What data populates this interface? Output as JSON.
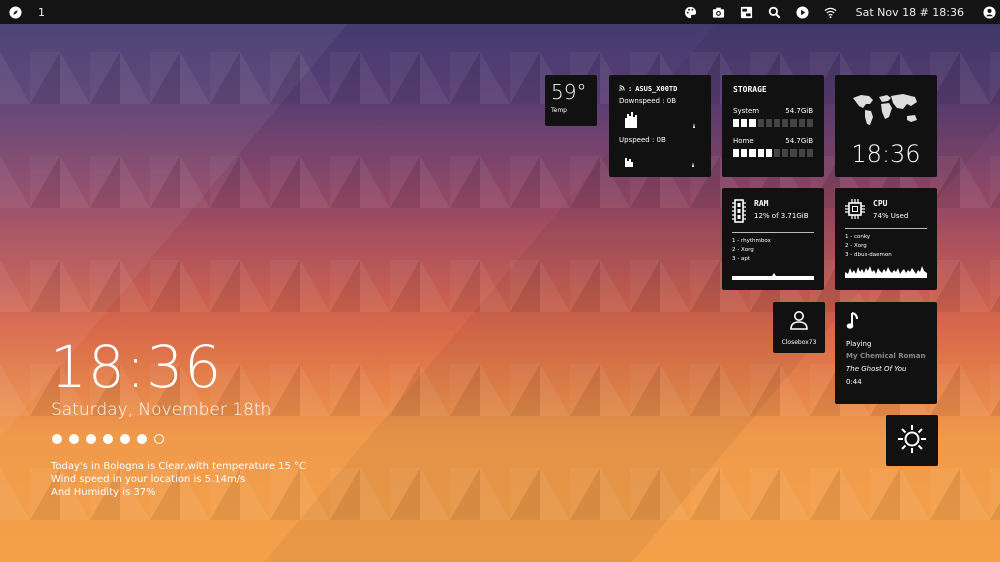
{
  "topbar": {
    "workspace": "1",
    "datetime": "Sat Nov 18 # 18:36",
    "icons": [
      "compass-icon",
      "palette-icon",
      "camera-icon",
      "toggle-icon",
      "search-icon",
      "play-icon",
      "wifi-icon",
      "user-icon"
    ]
  },
  "temp": {
    "value": "59°",
    "label": "Temp"
  },
  "network": {
    "ssid": "ASUS_X00TD",
    "down_label": "Downspeed : 0B",
    "up_label": "Upspeed : 0B"
  },
  "storage": {
    "title": "STORAGE",
    "system_label": "System",
    "system_size": "54.7GiB",
    "system_fill": 0.3,
    "home_label": "Home",
    "home_size": "54.7GiB",
    "home_fill": 0.5
  },
  "clock_widget": {
    "time": "18:36"
  },
  "ram": {
    "title": "RAM",
    "usage": "12% of 3.71GiB",
    "procs": [
      "1 - rhythmbox",
      "2 - Xorg",
      "3 - apt"
    ]
  },
  "cpu": {
    "title": "CPU",
    "usage": "74% Used",
    "procs": [
      "1 - conky",
      "2 - Xorg",
      "3 - dbus-daemon"
    ]
  },
  "user": {
    "name": "Closebox73"
  },
  "music": {
    "status": "Playing",
    "artist": "My Chemical Romance",
    "song": "The Ghost Of You",
    "time": "0:44"
  },
  "desktop": {
    "time": "18:36",
    "date": "Saturday, November 18th",
    "weather_line1": "Today's in Bologna is Clear,with temperature 15 °C",
    "weather_line2": "Wind speed in your location is 5.14m/s",
    "weather_line3": "And Humidity is 37%"
  }
}
